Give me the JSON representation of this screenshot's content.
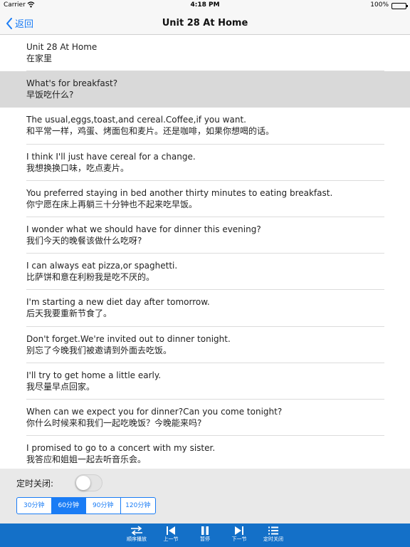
{
  "status": {
    "carrier": "Carrier",
    "time": "4:18 PM",
    "battery": "100%"
  },
  "nav": {
    "back_label": "返回",
    "title": "Unit 28 At Home"
  },
  "sentences": [
    {
      "en": "Unit 28 At Home",
      "zh": "在家里"
    },
    {
      "en": "What's for breakfast?",
      "zh": "早饭吃什么?"
    },
    {
      "en": "The usual,eggs,toast,and cereal.Coffee,if you want.",
      "zh": "和平常一样，鸡蛋、烤面包和麦片。还是咖啡，如果你想喝的话。"
    },
    {
      "en": "I think I'll just have cereal for a change.",
      "zh": "我想换换口味，吃点麦片。"
    },
    {
      "en": "You preferred staying in bed another thirty minutes to eating breakfast.",
      "zh": "你宁愿在床上再躺三十分钟也不起来吃早饭。"
    },
    {
      "en": "I wonder what we should have for dinner this evening?",
      "zh": "我们今天的晚餐该做什么吃呀?"
    },
    {
      "en": "I can always eat pizza,or spaghetti.",
      "zh": "比萨饼和意在利粉我是吃不厌的。"
    },
    {
      "en": "I'm starting a new diet day after tomorrow.",
      "zh": "后天我要重新节食了。"
    },
    {
      "en": "Don't forget.We're invited out to dinner tonight.",
      "zh": "别忘了今晚我们被邀请到外面去吃饭。"
    },
    {
      "en": "I'll try to get home a little early.",
      "zh": "我尽量早点回家。"
    },
    {
      "en": "When can we expect you for dinner?Can you come tonight?",
      "zh": "你什么时候来和我们一起吃晚饭？今晚能来吗?"
    },
    {
      "en": "I promised to go to a concert with my sister.",
      "zh": "我答应和姐姐一起去听音乐会。"
    }
  ],
  "selected_index": 1,
  "timer": {
    "label": "定时关闭:",
    "enabled": false,
    "options": [
      "30分钟",
      "60分钟",
      "90分钟",
      "120分钟"
    ],
    "selected_option": 1
  },
  "controls": {
    "order": "顺序播放",
    "prev": "上一节",
    "pause": "暂停",
    "next": "下一节",
    "timer": "定时关闭"
  },
  "colors": {
    "accent": "#1a7cf5",
    "bottom_bar": "#1470c8",
    "selected_row": "#d9d9d9"
  }
}
